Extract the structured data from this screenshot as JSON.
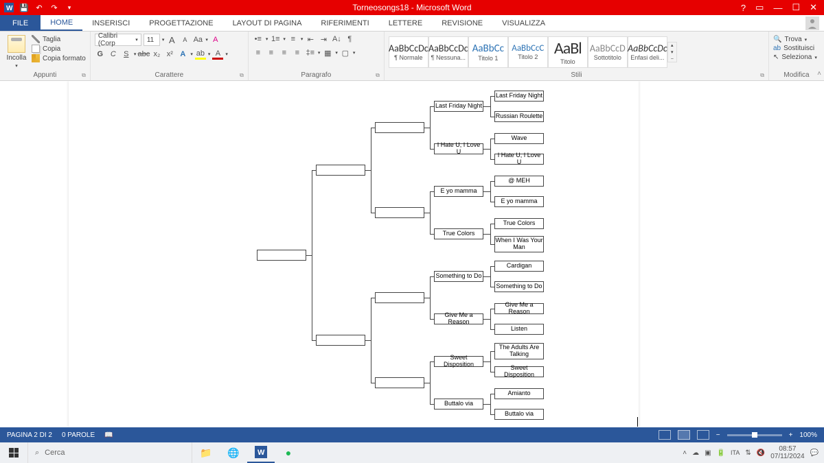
{
  "titlebar": {
    "title": "Torneosongs18 - Microsoft Word"
  },
  "tabs": {
    "file": "FILE",
    "home": "HOME",
    "insert": "INSERISCI",
    "design": "PROGETTAZIONE",
    "layout": "LAYOUT DI PAGINA",
    "references": "RIFERIMENTI",
    "mail": "LETTERE",
    "review": "REVISIONE",
    "view": "VISUALIZZA"
  },
  "clipboard": {
    "paste": "Incolla",
    "cut": "Taglia",
    "copy": "Copia",
    "format": "Copia formato",
    "group": "Appunti"
  },
  "font": {
    "name": "Calibri (Corp",
    "size": "11",
    "group": "Carattere",
    "bold": "G",
    "italic": "C",
    "underline": "S",
    "strike": "abc",
    "sub": "x₂",
    "sup": "x²",
    "case": "Aa",
    "bigA": "A",
    "smallA": "A"
  },
  "para": {
    "group": "Paragrafo"
  },
  "styles": {
    "group": "Stili",
    "s1": "¶ Normale",
    "s2": "¶ Nessuna...",
    "s3": "Titolo 1",
    "s4": "Titolo 2",
    "s5": "Titolo",
    "s6": "Sottotitolo",
    "s7": "Enfasi deli...",
    "prev": "AaBbCcDc",
    "prevH": "AaBbCc",
    "prevH2": "AaBbCcC",
    "prevT": "AaBl",
    "prevS": "AaBbCcD",
    "prevE": "AaBbCcDc"
  },
  "editing": {
    "find": "Trova",
    "replace": "Sostituisci",
    "select": "Seleziona",
    "group": "Modifica"
  },
  "bracket": {
    "r16": [
      "Last Friday Night",
      "Russian Roulette",
      "Wave",
      "I Hate U, I Love U",
      "@ MEH",
      "E yo mamma",
      "True Colors",
      "When I Was Your Man",
      "Cardigan",
      "Something to Do",
      "Give Me a Reason",
      "Listen",
      "The Adults Are Talking",
      "Sweet Disposition",
      "Amianto",
      "Buttalo via"
    ],
    "qf": [
      "Last Friday Night",
      "I Hate U, I Love U",
      "E yo mamma",
      "True Colors",
      "Something to Do",
      "Give Me a Reason",
      "Sweet Disposition",
      "Buttalo via"
    ],
    "sf": [
      "",
      "",
      "",
      ""
    ],
    "f": [
      "",
      ""
    ],
    "w": [
      ""
    ]
  },
  "status": {
    "page": "PAGINA 2 DI 2",
    "words": "0 PAROLE",
    "zoom": "100%"
  },
  "taskbar": {
    "search": "Cerca",
    "time": "08:57",
    "date": "07/11/2024"
  }
}
